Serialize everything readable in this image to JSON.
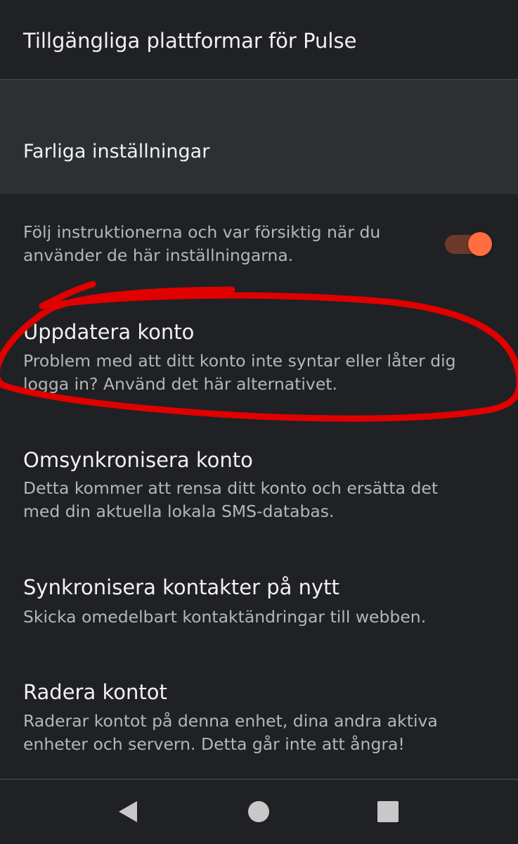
{
  "top_item": {
    "title": "Tillgängliga plattformar för Pulse"
  },
  "category": {
    "title": "Farliga inställningar"
  },
  "preferences": [
    {
      "id": "warning",
      "title": "",
      "summary_lines": [
        "Följ instruktionerna och var försiktig när du",
        "använder de här inställningarna."
      ],
      "switch_on": true
    },
    {
      "id": "update-account",
      "title": "Uppdatera konto",
      "summary_lines": [
        "Problem med att ditt konto inte syntar eller låter dig",
        "logga in? Använd det här alternativet."
      ]
    },
    {
      "id": "resync-account",
      "title": "Omsynkronisera konto",
      "summary_lines": [
        "Detta kommer att rensa ditt konto och ersätta det",
        "med din aktuella lokala SMS-databas."
      ]
    },
    {
      "id": "resync-contacts",
      "title": "Synkronisera kontakter på nytt",
      "summary_lines": [
        "Skicka omedelbart kontaktändringar till webben."
      ]
    },
    {
      "id": "delete-account",
      "title": "Radera kontot",
      "summary_lines": [
        "Raderar kontot på denna enhet, dina andra aktiva",
        "enheter och servern. Detta går inte att ångra!"
      ]
    }
  ],
  "navbar": {
    "icons": [
      "back-triangle-icon",
      "home-circle-icon",
      "recents-square-icon"
    ]
  },
  "colors": {
    "background": "#202124",
    "category_background": "#2d3033",
    "accent": "#ff6d40",
    "annotation": "#e00000"
  }
}
